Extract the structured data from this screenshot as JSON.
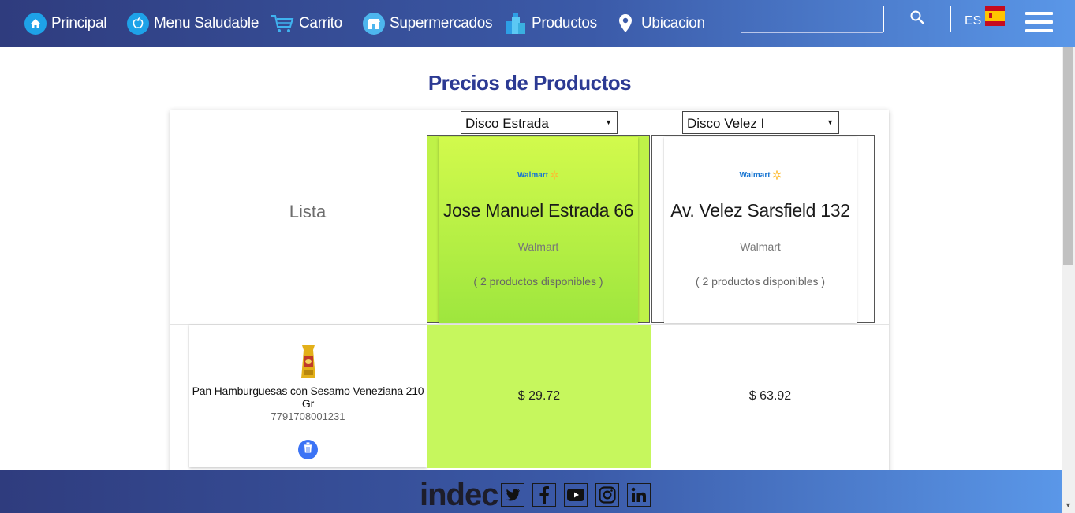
{
  "nav": {
    "items": [
      {
        "label": "Principal",
        "icon": "home-icon"
      },
      {
        "label": "Menu Saludable",
        "icon": "apple-icon"
      },
      {
        "label": "Carrito",
        "icon": "cart-icon"
      },
      {
        "label": "Supermercados",
        "icon": "store-icon"
      },
      {
        "label": "Productos",
        "icon": "products-icon"
      },
      {
        "label": "Ubicacion",
        "icon": "location-pin-icon"
      }
    ],
    "lang": "ES"
  },
  "page": {
    "title": "Precios de Productos",
    "list_label": "Lista"
  },
  "stores": [
    {
      "select_value": "Disco Estrada",
      "brand": "Walmart",
      "address": "Jose Manuel Estrada 66",
      "chain": "Walmart",
      "availability": "( 2 productos disponibles )",
      "selected": true
    },
    {
      "select_value": "Disco Velez I",
      "brand": "Walmart",
      "address": "Av. Velez Sarsfield 132",
      "chain": "Walmart",
      "availability": "( 2 productos disponibles )",
      "selected": false
    }
  ],
  "products": [
    {
      "name": "Pan Hamburguesas con Sesamo Veneziana 210 Gr",
      "code": "7791708001231",
      "prices": [
        "$ 29.72",
        "$ 63.92"
      ]
    }
  ],
  "footer": {
    "logo": "indec",
    "social": [
      "twitter-icon",
      "facebook-icon",
      "youtube-icon",
      "instagram-icon",
      "linkedin-icon"
    ]
  },
  "colors": {
    "nav_start": "#2f3c7e",
    "nav_end": "#5a97e8",
    "title": "#2c3a93",
    "highlight_green": "#c6f75d",
    "trash_blue": "#3b73f5"
  }
}
